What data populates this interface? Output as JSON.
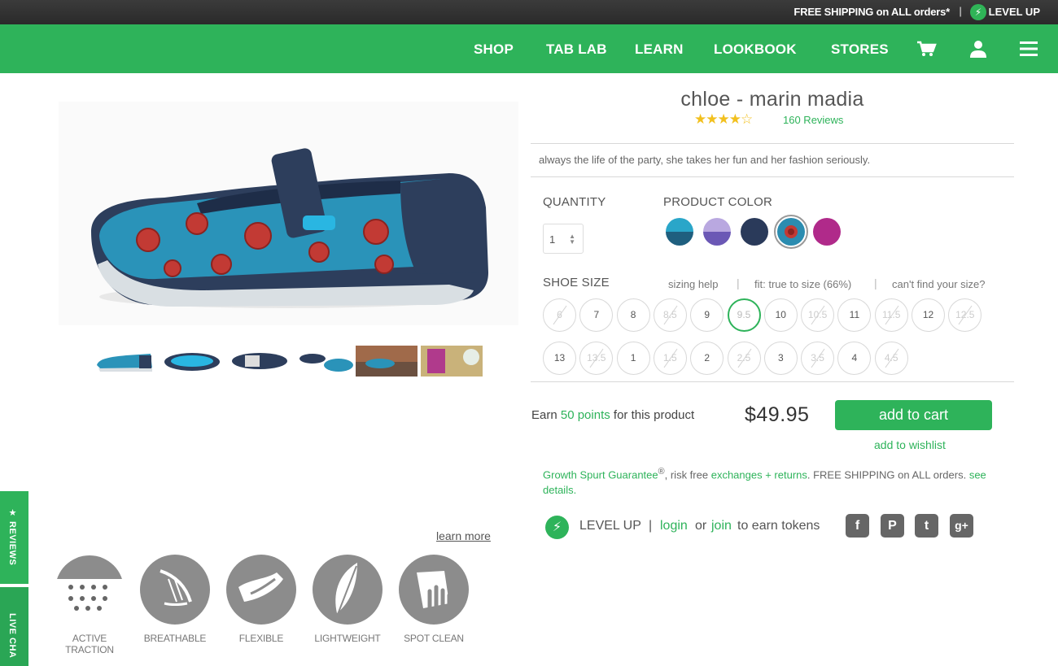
{
  "topbar": {
    "shipping": "FREE SHIPPING on ALL orders*",
    "separator": "|",
    "level_up": "LEVEL UP"
  },
  "nav": {
    "items": [
      "SHOP",
      "TAB LAB",
      "LEARN",
      "LOOKBOOK",
      "STORES"
    ],
    "icons": [
      "cart-icon",
      "user-icon",
      "menu-icon"
    ]
  },
  "product": {
    "title": "chloe - marin madia",
    "rating": 4.5,
    "stars": "★★★★☆",
    "reviews": "160 Reviews",
    "tagline": "always the life of the party, she takes her fun and her fashion seriously."
  },
  "quantity": {
    "label": "QUANTITY",
    "value": "1"
  },
  "color": {
    "label": "PRODUCT COLOR",
    "swatches": [
      {
        "name": "teal",
        "top": "#2aa6c9",
        "bottom": "#1f5f7f"
      },
      {
        "name": "lavender",
        "top": "#b9a8e0",
        "bottom": "#6b58b5"
      },
      {
        "name": "navy",
        "top": "#2a3a5a",
        "bottom": "#2a3a5a"
      },
      {
        "name": "marin madia",
        "top": "#2b8cb0",
        "bottom": "#2b8cb0",
        "selected": true
      },
      {
        "name": "magenta",
        "top": "#b02a8a",
        "bottom": "#b02a8a"
      }
    ]
  },
  "size": {
    "label": "SHOE SIZE",
    "help": "sizing help",
    "fit": "fit: true to size (66%)",
    "cant_find": "can't find your size?",
    "sep": "|",
    "row1": [
      {
        "v": "6",
        "na": true
      },
      {
        "v": "7"
      },
      {
        "v": "8"
      },
      {
        "v": "8.5",
        "na": true
      },
      {
        "v": "9"
      },
      {
        "v": "9.5",
        "sel": true
      },
      {
        "v": "10"
      },
      {
        "v": "10.5",
        "na": true
      },
      {
        "v": "11"
      },
      {
        "v": "11.5",
        "na": true
      },
      {
        "v": "12"
      },
      {
        "v": "12.5",
        "na": true
      }
    ],
    "row2": [
      {
        "v": "13"
      },
      {
        "v": "13.5",
        "na": true
      },
      {
        "v": "1"
      },
      {
        "v": "1.5",
        "na": true
      },
      {
        "v": "2"
      },
      {
        "v": "2.5",
        "na": true
      },
      {
        "v": "3"
      },
      {
        "v": "3.5",
        "na": true
      },
      {
        "v": "4"
      },
      {
        "v": "4.5",
        "na": true
      }
    ]
  },
  "purchase": {
    "earn_pre": "Earn",
    "points": "50 points",
    "earn_post": "for this product",
    "price": "$49.95",
    "add_to_cart": "add to cart",
    "wishlist": "add to wishlist"
  },
  "guarantee": {
    "g1": "Growth Spurt Guarantee",
    "reg": "®",
    "t1": ", risk free",
    "link1": "exchanges + returns",
    "t2": ". FREE SHIPPING on ALL orders.",
    "link2": "see details."
  },
  "levelup": {
    "label": "LEVEL UP",
    "sep": "|",
    "login": "login",
    "or": "or",
    "join": "join",
    "post": "to earn tokens"
  },
  "social": [
    {
      "name": "facebook-icon",
      "glyph": "f"
    },
    {
      "name": "pinterest-icon",
      "glyph": "P"
    },
    {
      "name": "twitter-icon",
      "glyph": "t"
    },
    {
      "name": "googleplus-icon",
      "glyph": "g+"
    }
  ],
  "features": {
    "learn_more": "learn more",
    "items": [
      "ACTIVE TRACTION",
      "BREATHABLE",
      "FLEXIBLE",
      "LIGHTWEIGHT",
      "SPOT CLEAN"
    ]
  },
  "side_tabs": {
    "reviews": "★ REVIEWS",
    "chat": "LIVE CHA"
  },
  "colors": {
    "brand": "#2eb35a",
    "star": "#f2c01e"
  }
}
